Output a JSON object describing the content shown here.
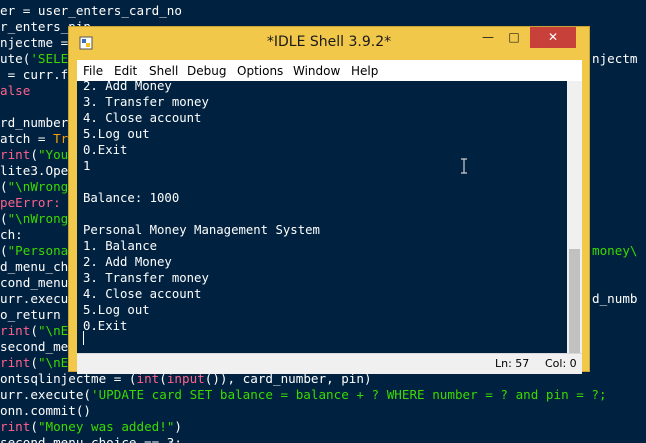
{
  "editor": {
    "lines": [
      [
        {
          "t": "er = user_enters_card_no",
          "c": "w"
        }
      ],
      [
        {
          "t": "r_enters_pin",
          "c": "w"
        }
      ],
      [
        {
          "t": "njectme = ",
          "c": "w"
        }
      ],
      [
        {
          "t": "ute(",
          "c": "w"
        },
        {
          "t": "'SELE",
          "c": "s"
        }
      ],
      [
        {
          "t": " = curr.f",
          "c": "w"
        }
      ],
      [
        {
          "t": "alse",
          "c": "b"
        }
      ],
      [
        {
          "t": "",
          "c": "w"
        }
      ],
      [
        {
          "t": "rd_number",
          "c": "w"
        }
      ],
      [
        {
          "t": "atch = ",
          "c": "w"
        },
        {
          "t": "Tr",
          "c": "k"
        }
      ],
      [
        {
          "t": "rint",
          "c": "b"
        },
        {
          "t": "(",
          "c": "w"
        },
        {
          "t": "\"You",
          "c": "s"
        }
      ],
      [
        {
          "t": "lite3.Ope",
          "c": "w"
        }
      ],
      [
        {
          "t": "(",
          "c": "w"
        },
        {
          "t": "\"\\nWrong",
          "c": "s"
        }
      ],
      [
        {
          "t": "peError:",
          "c": "b"
        }
      ],
      [
        {
          "t": "(",
          "c": "w"
        },
        {
          "t": "\"\\nWrong",
          "c": "s"
        }
      ],
      [
        {
          "t": "ch:",
          "c": "w"
        }
      ],
      [
        {
          "t": "(",
          "c": "w"
        },
        {
          "t": "\"Persona",
          "c": "s"
        }
      ],
      [
        {
          "t": "d_menu_ch",
          "c": "w"
        }
      ],
      [
        {
          "t": "cond_menu",
          "c": "w"
        }
      ],
      [
        {
          "t": "urr.execu",
          "c": "w"
        }
      ],
      [
        {
          "t": "o_return ",
          "c": "w"
        }
      ],
      [
        {
          "t": "rint",
          "c": "b"
        },
        {
          "t": "(",
          "c": "w"
        },
        {
          "t": "\"\\nE",
          "c": "s"
        }
      ],
      [
        {
          "t": "second_me",
          "c": "w"
        }
      ],
      [
        {
          "t": "rint",
          "c": "b"
        },
        {
          "t": "(",
          "c": "w"
        },
        {
          "t": "\"\\nE",
          "c": "s"
        }
      ],
      [
        {
          "t": "ontsqlinjectme = (",
          "c": "w"
        },
        {
          "t": "int",
          "c": "b"
        },
        {
          "t": "(",
          "c": "w"
        },
        {
          "t": "input",
          "c": "b"
        },
        {
          "t": "()), card_number, pin)",
          "c": "w"
        }
      ],
      [
        {
          "t": "urr.execute(",
          "c": "w"
        },
        {
          "t": "'UPDATE card SET balance = balance + ? WHERE number = ? and pin = ?;",
          "c": "s"
        }
      ],
      [
        {
          "t": "onn.commit()",
          "c": "w"
        }
      ],
      [
        {
          "t": "rint",
          "c": "b"
        },
        {
          "t": "(",
          "c": "w"
        },
        {
          "t": "\"Money was added!\"",
          "c": "s"
        },
        {
          "t": ")",
          "c": "w"
        }
      ],
      [
        {
          "t": "second_menu_choice == 3:",
          "c": "w"
        }
      ]
    ],
    "right_fragments": [
      {
        "line": 3,
        "text": "njectm",
        "c": "w"
      },
      {
        "line": 15,
        "text": "money\\",
        "c": "s"
      },
      {
        "line": 18,
        "text": "d_numb",
        "c": "w"
      }
    ]
  },
  "window": {
    "title": "*IDLE Shell 3.9.2*",
    "minimize_glyph": "—",
    "maximize_glyph": "□",
    "close_glyph": "✕"
  },
  "menu": [
    {
      "label": "File"
    },
    {
      "label": "Edit"
    },
    {
      "label": "Shell"
    },
    {
      "label": "Debug"
    },
    {
      "label": "Options"
    },
    {
      "label": "Window"
    },
    {
      "label": "Help"
    }
  ],
  "shell_lines": [
    "2. Add Money",
    "3. Transfer money",
    "4. Close account",
    "5.Log out",
    "0.Exit",
    "1",
    "",
    "Balance: 1000",
    "",
    "Personal Money Management System",
    "1. Balance",
    "2. Add Money",
    "3. Transfer money",
    "4. Close account",
    "5.Log out",
    "0.Exit"
  ],
  "status": {
    "line": "Ln: 57",
    "col": "Col: 0"
  },
  "colors": {
    "editor_bg": "#002240",
    "window_border": "#f2c84b",
    "close_button": "#c7403a",
    "string": "#3ad900",
    "keyword": "#ff9d00",
    "builtin": "#ff628c"
  }
}
